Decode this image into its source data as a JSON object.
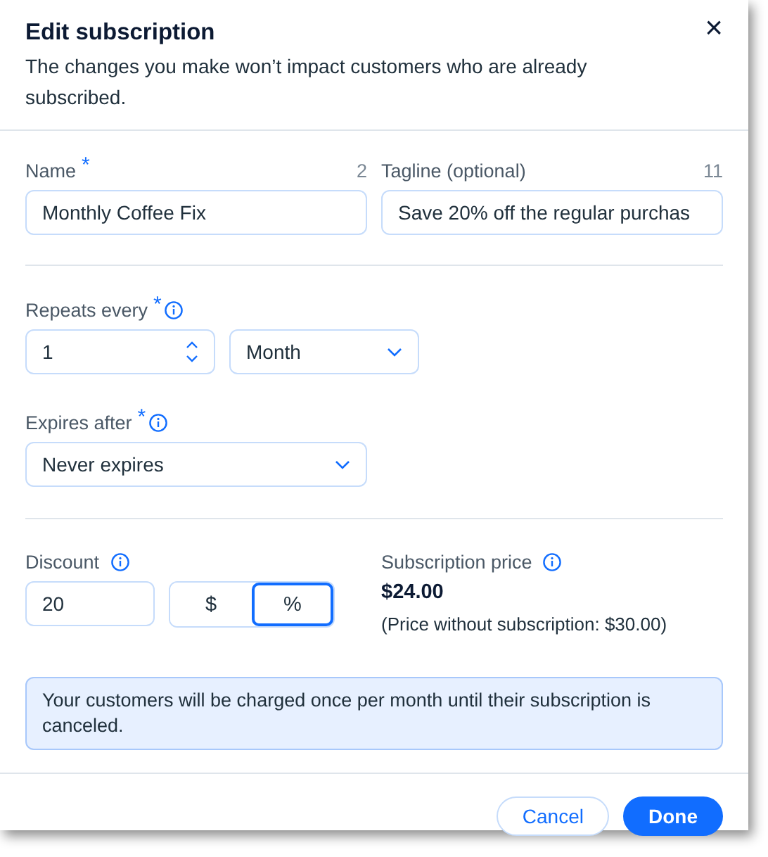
{
  "dialog": {
    "title": "Edit subscription",
    "subtitle": "The changes you make won’t impact customers who are already subscribed.",
    "close": "×"
  },
  "name_field": {
    "label": "Name",
    "required_mark": "*",
    "count": "2",
    "value": "Monthly Coffee Fix"
  },
  "tagline_field": {
    "label": "Tagline (optional)",
    "count": "11",
    "value": "Save 20% off the regular purchas"
  },
  "repeats_every": {
    "label": "Repeats every",
    "required_mark": "*",
    "value": "1",
    "unit": "Month"
  },
  "expires_after": {
    "label": "Expires after",
    "required_mark": "*",
    "value": "Never expires"
  },
  "discount": {
    "label": "Discount",
    "value": "20",
    "units": [
      {
        "label": "$",
        "selected": false
      },
      {
        "label": "%",
        "selected": true
      }
    ]
  },
  "subscription_price": {
    "label": "Subscription price",
    "price": "$24.00",
    "note": "(Price without subscription: $30.00)"
  },
  "info_message": "Your customers will be charged once per month until their subscription is canceled.",
  "buttons": [
    {
      "label": "Cancel",
      "kind": "secondary"
    },
    {
      "label": "Done",
      "kind": "primary"
    }
  ]
}
